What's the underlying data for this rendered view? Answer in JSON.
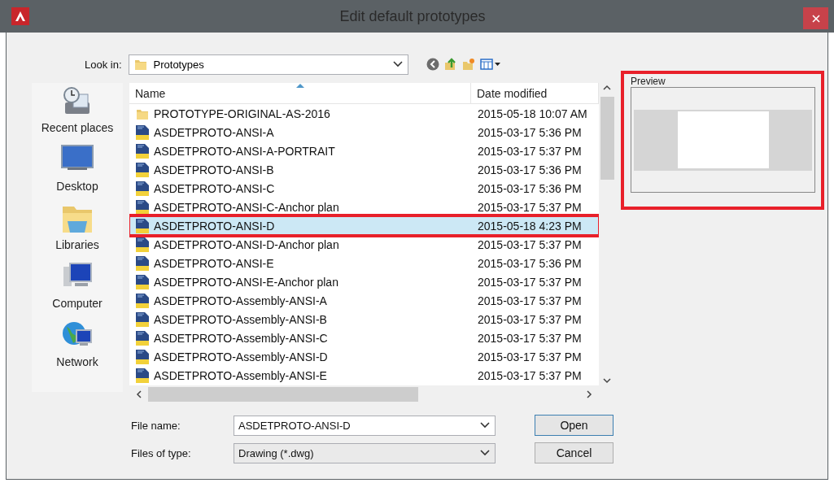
{
  "window": {
    "title": "Edit default prototypes"
  },
  "look_in": {
    "label": "Look in:",
    "value": "Prototypes"
  },
  "places": [
    {
      "label": "Recent places",
      "kind": "recent"
    },
    {
      "label": "Desktop",
      "kind": "desktop"
    },
    {
      "label": "Libraries",
      "kind": "libraries"
    },
    {
      "label": "Computer",
      "kind": "computer"
    },
    {
      "label": "Network",
      "kind": "network"
    }
  ],
  "table": {
    "columns": [
      "Name",
      "Date modified"
    ],
    "rows": [
      {
        "kind": "folder",
        "name": "PROTOTYPE-ORIGINAL-AS-2016",
        "date": "2015-05-18 10:07 AM",
        "selected": false
      },
      {
        "kind": "dwg",
        "name": "ASDETPROTO-ANSI-A",
        "date": "2015-03-17 5:36 PM",
        "selected": false
      },
      {
        "kind": "dwg",
        "name": "ASDETPROTO-ANSI-A-PORTRAIT",
        "date": "2015-03-17 5:37 PM",
        "selected": false
      },
      {
        "kind": "dwg",
        "name": "ASDETPROTO-ANSI-B",
        "date": "2015-03-17 5:36 PM",
        "selected": false
      },
      {
        "kind": "dwg",
        "name": "ASDETPROTO-ANSI-C",
        "date": "2015-03-17 5:36 PM",
        "selected": false
      },
      {
        "kind": "dwg",
        "name": "ASDETPROTO-ANSI-C-Anchor plan",
        "date": "2015-03-17 5:37 PM",
        "selected": false
      },
      {
        "kind": "dwg",
        "name": "ASDETPROTO-ANSI-D",
        "date": "2015-05-18 4:23 PM",
        "selected": true
      },
      {
        "kind": "dwg",
        "name": "ASDETPROTO-ANSI-D-Anchor plan",
        "date": "2015-03-17 5:37 PM",
        "selected": false
      },
      {
        "kind": "dwg",
        "name": "ASDETPROTO-ANSI-E",
        "date": "2015-03-17 5:36 PM",
        "selected": false
      },
      {
        "kind": "dwg",
        "name": "ASDETPROTO-ANSI-E-Anchor plan",
        "date": "2015-03-17 5:37 PM",
        "selected": false
      },
      {
        "kind": "dwg",
        "name": "ASDETPROTO-Assembly-ANSI-A",
        "date": "2015-03-17 5:37 PM",
        "selected": false
      },
      {
        "kind": "dwg",
        "name": "ASDETPROTO-Assembly-ANSI-B",
        "date": "2015-03-17 5:37 PM",
        "selected": false
      },
      {
        "kind": "dwg",
        "name": "ASDETPROTO-Assembly-ANSI-C",
        "date": "2015-03-17 5:37 PM",
        "selected": false
      },
      {
        "kind": "dwg",
        "name": "ASDETPROTO-Assembly-ANSI-D",
        "date": "2015-03-17 5:37 PM",
        "selected": false
      },
      {
        "kind": "dwg",
        "name": "ASDETPROTO-Assembly-ANSI-E",
        "date": "2015-03-17 5:37 PM",
        "selected": false
      }
    ]
  },
  "preview": {
    "label": "Preview"
  },
  "file_name": {
    "label": "File name:",
    "value": "ASDETPROTO-ANSI-D"
  },
  "file_type": {
    "label": "Files of type:",
    "value": "Drawing (*.dwg)"
  },
  "buttons": [
    "Open",
    "Cancel"
  ]
}
